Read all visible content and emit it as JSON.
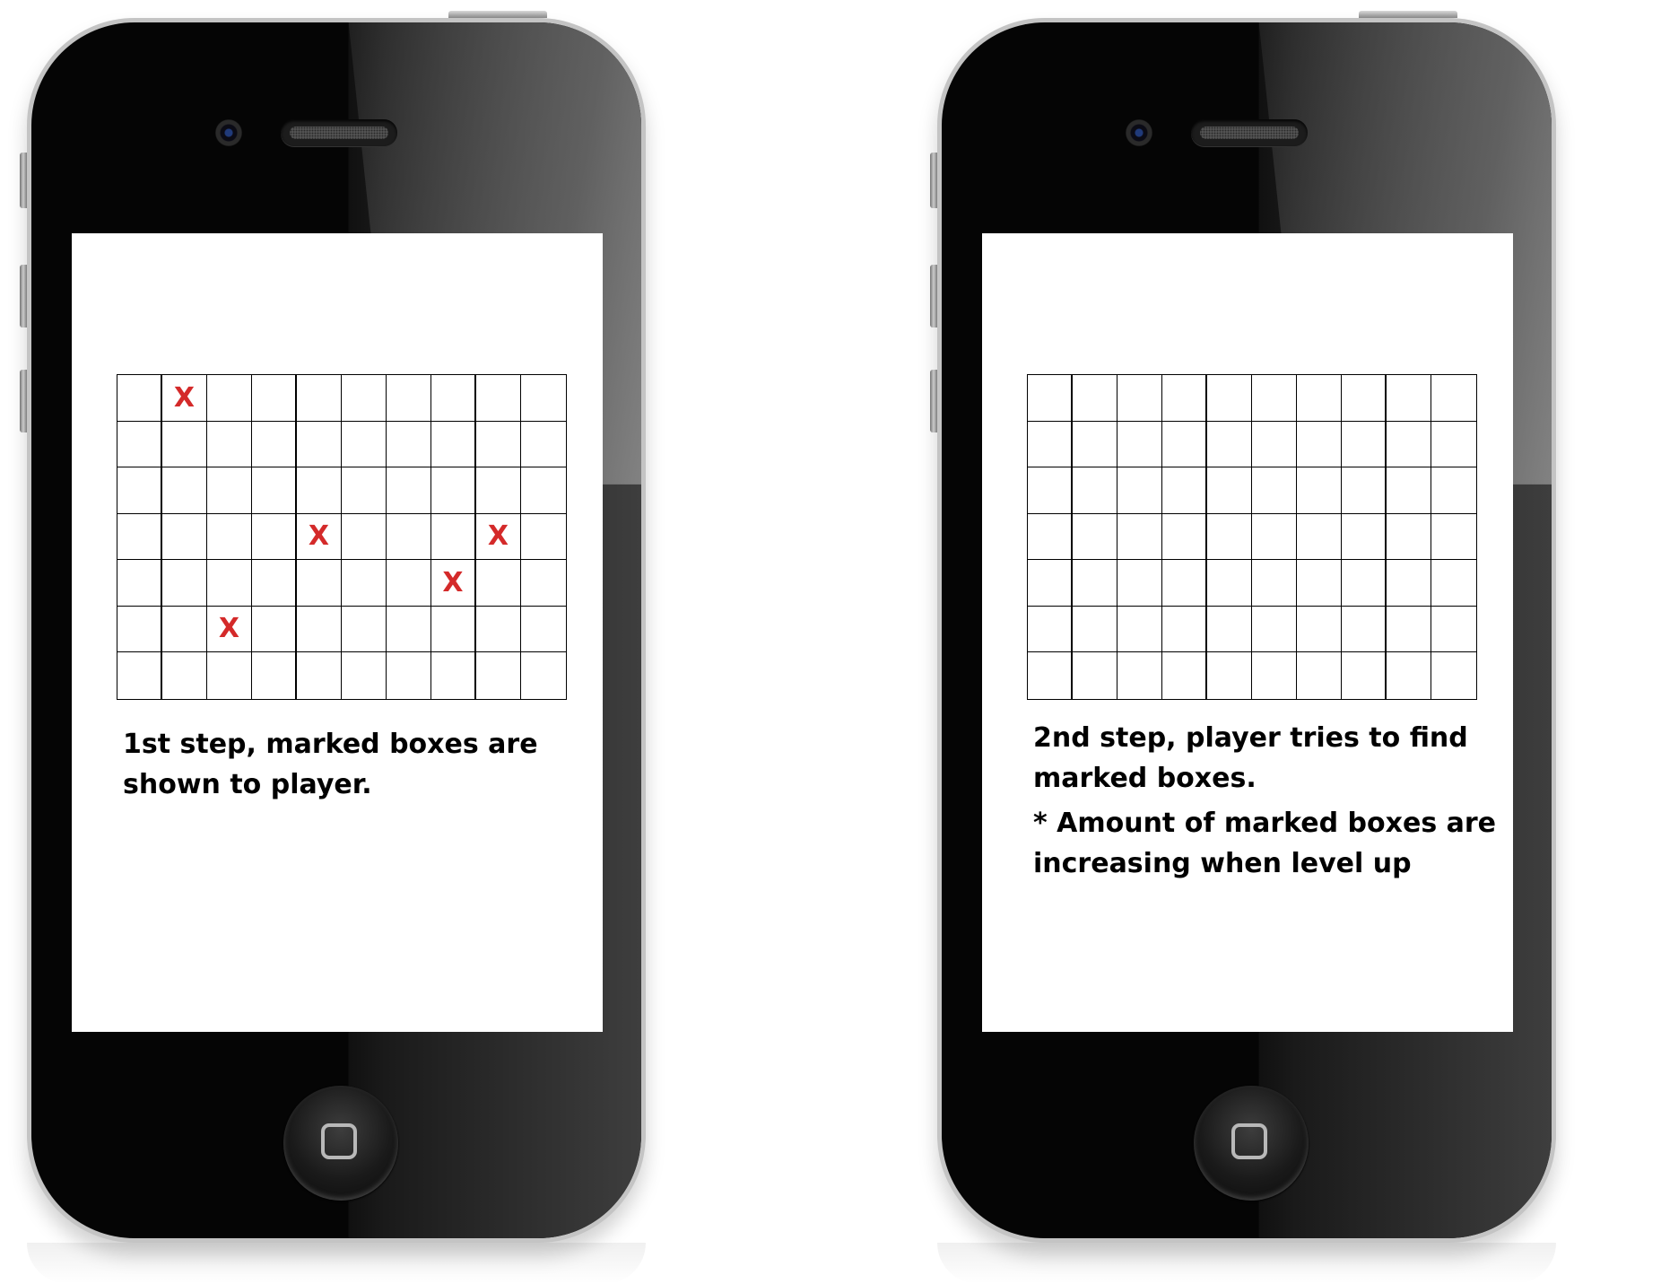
{
  "phones": [
    {
      "caption": "1st step, marked boxes are shown to player.",
      "note": "",
      "grid": {
        "columns": 10,
        "rows": 7,
        "mark_symbol": "X",
        "mark_color": "#d42a2a",
        "marks": [
          [
            0,
            1
          ],
          [
            3,
            4
          ],
          [
            3,
            8
          ],
          [
            4,
            7
          ],
          [
            5,
            2
          ]
        ]
      }
    },
    {
      "caption": "2nd step, player tries to find marked boxes.",
      "note": "* Amount of marked boxes are increasing when level up",
      "grid": {
        "columns": 10,
        "rows": 7,
        "mark_symbol": "X",
        "mark_color": "#d42a2a",
        "marks": []
      }
    }
  ],
  "icons": {
    "camera": "camera-icon",
    "speaker": "speaker-icon",
    "home": "home-button-icon"
  }
}
